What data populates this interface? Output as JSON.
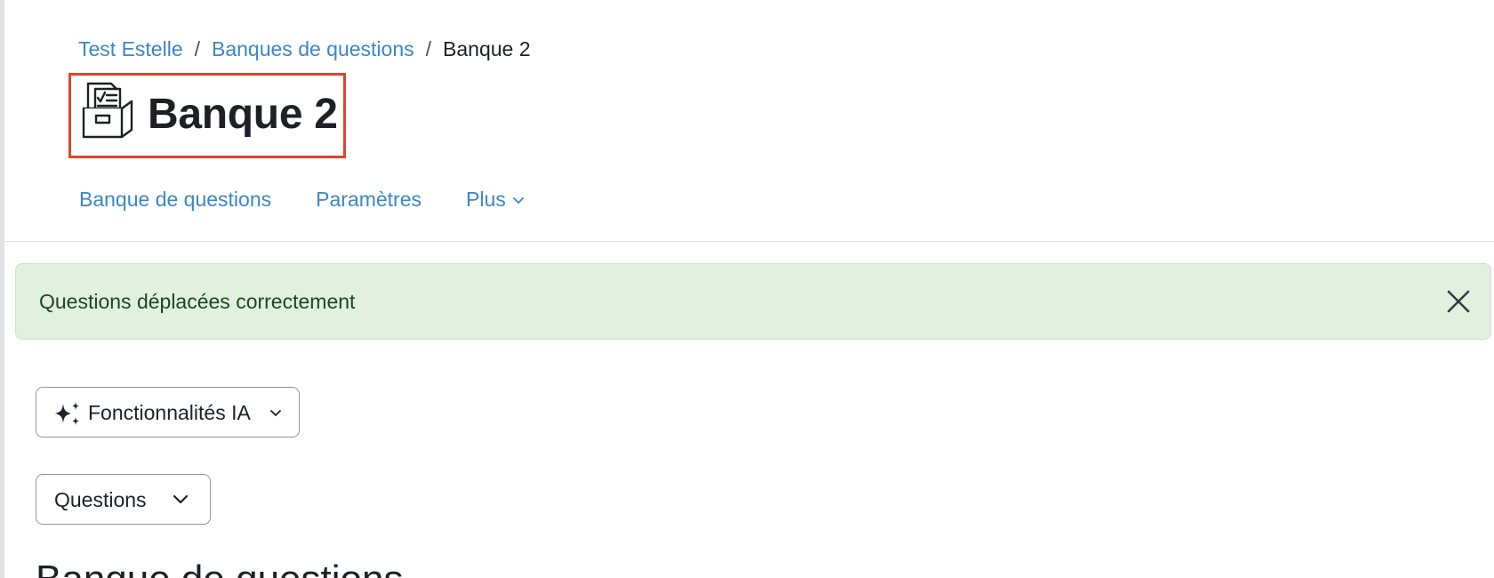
{
  "breadcrumb": {
    "items": [
      {
        "label": "Test Estelle",
        "link": true
      },
      {
        "label": "Banques de questions",
        "link": true
      },
      {
        "label": "Banque 2",
        "link": false
      }
    ],
    "separator": "/"
  },
  "header": {
    "title": "Banque 2",
    "icon": "question-bank-icon"
  },
  "secondary_nav": {
    "items": [
      {
        "label": "Banque de questions"
      },
      {
        "label": "Paramètres"
      },
      {
        "label": "Plus",
        "icon": "chevron-down-icon"
      }
    ]
  },
  "alert": {
    "message": "Questions déplacées correctement",
    "type": "success",
    "close_icon": "close-icon"
  },
  "ai_features": {
    "label": "Fonctionnalités IA",
    "icon": "sparkle-icon"
  },
  "questions_select": {
    "value": "Questions"
  },
  "main": {
    "heading": "Banque de questions"
  },
  "colors": {
    "link": "#3a87c8",
    "text": "#1d2125",
    "alert_background": "#e1f0df",
    "alert_text": "#1e4620",
    "highlight_border": "#e0452a"
  }
}
